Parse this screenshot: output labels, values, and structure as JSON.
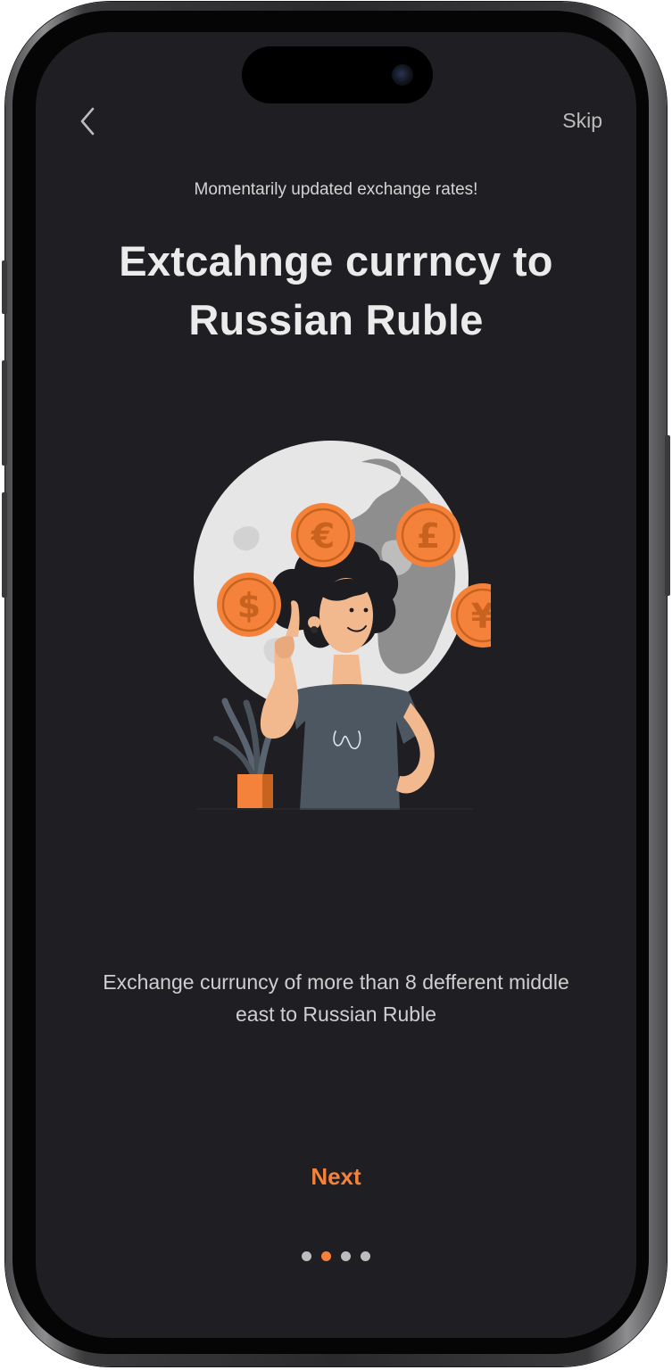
{
  "nav": {
    "back_icon": "chevron-left-icon",
    "skip_label": "Skip"
  },
  "onboarding": {
    "eyebrow": "Momentarily updated exchange rates!",
    "headline_line1": "Extcahnge currncy to",
    "headline_line2": "Russian Ruble",
    "description_line1": "Exchange curruncy of more than 8 defferent middle",
    "description_line2": "east to Russian Ruble",
    "next_label": "Next"
  },
  "pagination": {
    "total": 4,
    "active_index": 1
  },
  "illustration": {
    "coins": [
      "€",
      "£",
      "$",
      "¥"
    ]
  },
  "colors": {
    "background": "#1f1e22",
    "accent": "#f5823a",
    "text_primary": "#ebebeb",
    "text_secondary": "#cfcfcf",
    "dot_inactive": "#bdbdbd"
  }
}
